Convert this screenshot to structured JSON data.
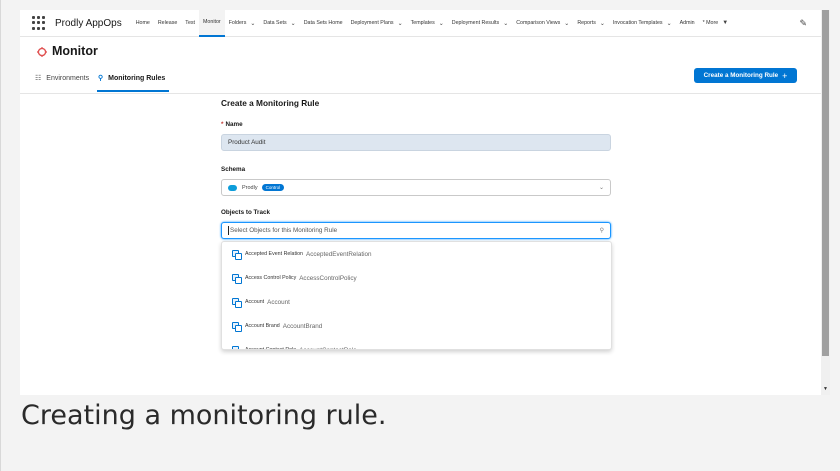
{
  "app_name": "Prodly AppOps",
  "nav": {
    "items": [
      {
        "label": "Home",
        "dropdown": false,
        "active": false
      },
      {
        "label": "Release",
        "dropdown": false,
        "active": false
      },
      {
        "label": "Test",
        "dropdown": false,
        "active": false
      },
      {
        "label": "Monitor",
        "dropdown": false,
        "active": true
      },
      {
        "label": "Folders",
        "dropdown": true,
        "active": false
      },
      {
        "label": "Data Sets",
        "dropdown": true,
        "active": false
      },
      {
        "label": "Data Sets Home",
        "dropdown": false,
        "active": false
      },
      {
        "label": "Deployment Plans",
        "dropdown": true,
        "active": false
      },
      {
        "label": "Templates",
        "dropdown": true,
        "active": false
      },
      {
        "label": "Deployment Results",
        "dropdown": true,
        "active": false
      },
      {
        "label": "Comparison Views",
        "dropdown": true,
        "active": false
      },
      {
        "label": "Reports",
        "dropdown": true,
        "active": false
      },
      {
        "label": "Invocation Templates",
        "dropdown": true,
        "active": false
      },
      {
        "label": "Admin",
        "dropdown": false,
        "active": false
      },
      {
        "label": "* More",
        "dropdown": true,
        "active": false
      }
    ],
    "chevron": "⌄",
    "more_chevron": "▼"
  },
  "header": {
    "title": "Monitor",
    "tabs": {
      "environments": "Environments",
      "rules": "Monitoring Rules"
    },
    "create_button": "Create a Monitoring Rule",
    "create_plus": "+"
  },
  "form": {
    "title": "Create a Monitoring Rule",
    "name_required": "*",
    "name_label": "Name",
    "name_value": "Product Audit",
    "schema_label": "Schema",
    "schema_value": "Prodly",
    "schema_badge": "Control",
    "objects_label": "Objects to Track",
    "objects_placeholder": "Select Objects for this Monitoring Rule"
  },
  "dropdown_options": [
    {
      "label": "Accepted Event Relation",
      "api": "AcceptedEventRelation"
    },
    {
      "label": "Access Control Policy",
      "api": "AccessControlPolicy"
    },
    {
      "label": "Account",
      "api": "Account"
    },
    {
      "label": "Account Brand",
      "api": "AccountBrand"
    },
    {
      "label": "Account Contact Role",
      "api": "AccountContactRole"
    }
  ],
  "caption": "Creating a monitoring rule.",
  "icons": {
    "monitor": "monitor-icon",
    "pencil": "✎",
    "search": "⚲",
    "grid": "☷"
  },
  "colors": {
    "brand_blue": "#0176d3",
    "required_red": "#c23934",
    "monitor_red": "#e05252"
  }
}
